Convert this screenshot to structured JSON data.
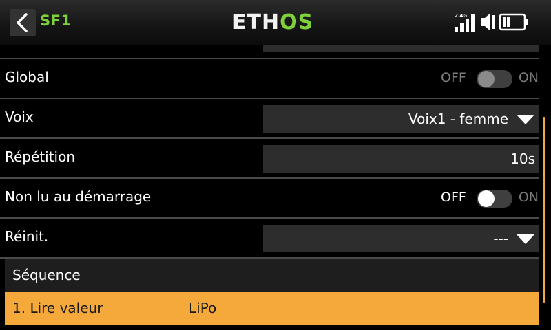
{
  "header": {
    "title": "SF1",
    "logo_part1": "ETH",
    "logo_part2": "OS",
    "signal_label": "2.4G"
  },
  "settings": [
    {
      "label": "Global",
      "type": "toggle",
      "off_label": "OFF",
      "on_label": "ON",
      "state": "off",
      "enabled": false
    },
    {
      "label": "Voix",
      "type": "dropdown",
      "value": "Voix1 - femme"
    },
    {
      "label": "Répétition",
      "type": "value",
      "value": "10s"
    },
    {
      "label": "Non lu au démarrage",
      "type": "toggle",
      "off_label": "OFF",
      "on_label": "ON",
      "state": "off",
      "enabled": true
    },
    {
      "label": "Réinit.",
      "type": "dropdown",
      "value": "---"
    }
  ],
  "sequence": {
    "title": "Séquence",
    "items": [
      {
        "action": "1. Lire valeur",
        "value": "LiPo"
      }
    ]
  },
  "colors": {
    "accent_green": "#7fd13b",
    "accent_orange": "#f4a93a",
    "field_bg": "#2d2d2d"
  }
}
